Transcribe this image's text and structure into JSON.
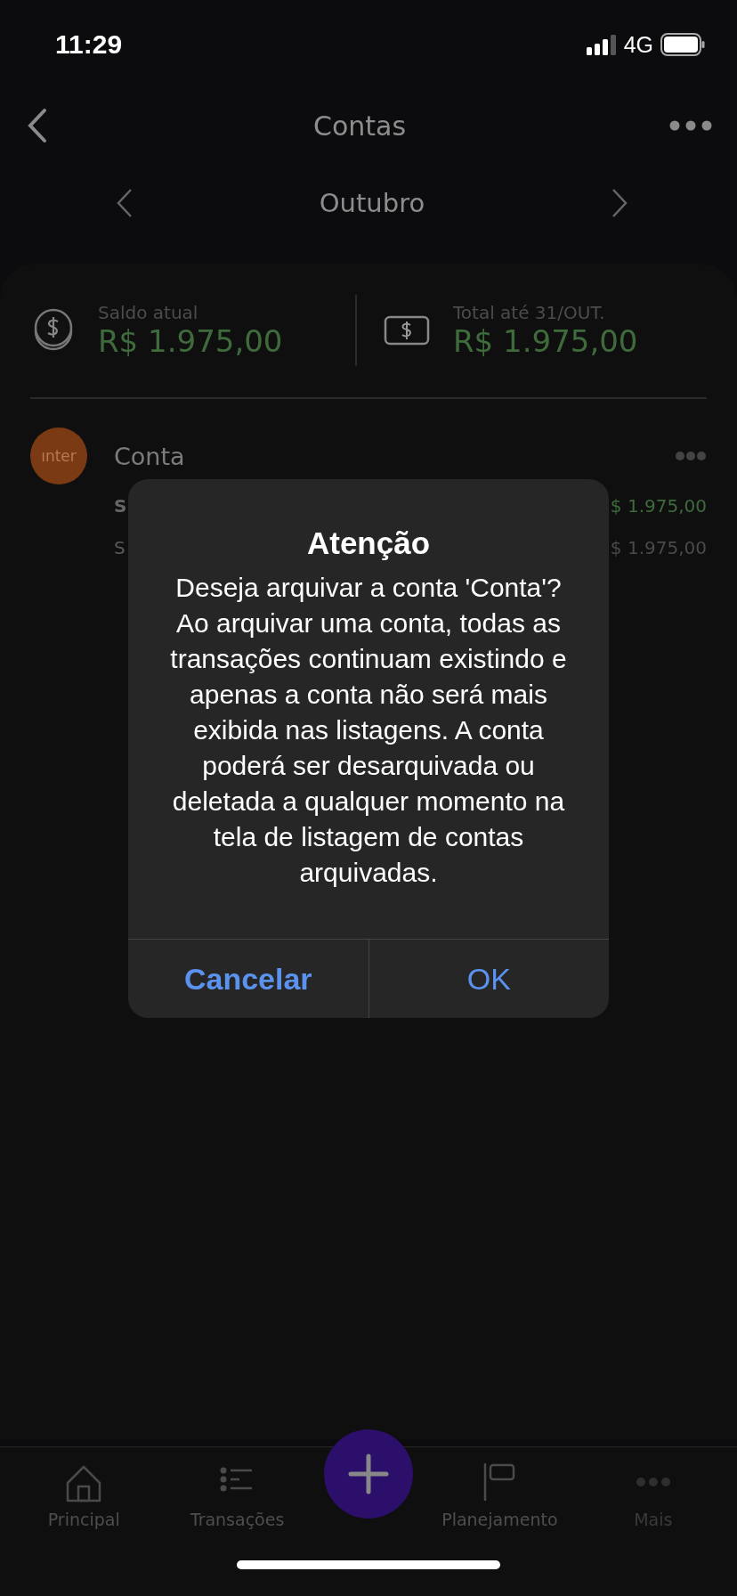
{
  "status_bar": {
    "time": "11:29",
    "network": "4G"
  },
  "header": {
    "title": "Contas"
  },
  "month_selector": {
    "label": "Outubro"
  },
  "summary": [
    {
      "kind": "coins",
      "label": "Saldo atual",
      "value": "R$ 1.975,00"
    },
    {
      "kind": "bill",
      "label": "Total até 31/OUT.",
      "value": "R$ 1.975,00"
    }
  ],
  "account": {
    "logo": "ınter",
    "name": "Conta",
    "rows": [
      {
        "label": "S",
        "value": "$ 1.975,00",
        "kind": "positive"
      },
      {
        "label": "S",
        "value": "$ 1.975,00",
        "kind": "neutral"
      }
    ]
  },
  "dialog": {
    "title": "Atenção",
    "message": "Deseja arquivar a conta 'Conta'? Ao arquivar uma conta, todas as transações continuam existindo e apenas a conta não será mais exibida nas listagens. A conta poderá ser desarquivada ou deletada a qualquer momento na tela de listagem de contas arquivadas.",
    "buttons": [
      {
        "label": "Cancelar",
        "kind": "cancel"
      },
      {
        "label": "OK",
        "kind": "default"
      }
    ]
  },
  "tab_bar": [
    {
      "kind": "home",
      "label": "Principal",
      "disabled": false
    },
    {
      "kind": "list",
      "label": "Transações",
      "disabled": false
    },
    {
      "kind": "add"
    },
    {
      "kind": "flag",
      "label": "Planejamento",
      "disabled": false
    },
    {
      "kind": "more",
      "label": "Mais",
      "disabled": true
    }
  ]
}
